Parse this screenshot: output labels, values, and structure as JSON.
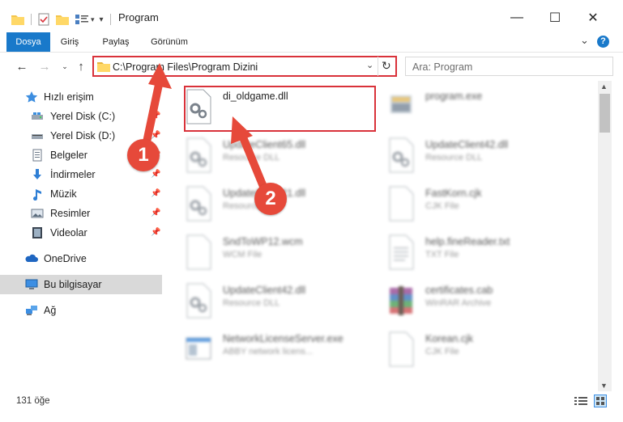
{
  "window": {
    "title": "Program",
    "minimize": "—",
    "maximize": "☐",
    "close": "✕"
  },
  "ribbon": {
    "tabs": [
      {
        "label": "Dosya",
        "active": true
      },
      {
        "label": "Giriş"
      },
      {
        "label": "Paylaş"
      },
      {
        "label": "Görünüm"
      }
    ],
    "expand": "⌄",
    "help": "?"
  },
  "address": {
    "path": "C:\\Program Files\\Program Dizini",
    "search_placeholder": "Ara: Program"
  },
  "nav": {
    "quick_access": "Hızlı erişim",
    "items": [
      {
        "label": "Yerel Disk (C:)",
        "icon": "drive-icon"
      },
      {
        "label": "Yerel Disk (D:)",
        "icon": "drive-icon"
      },
      {
        "label": "Belgeler",
        "icon": "documents-icon"
      },
      {
        "label": "İndirmeler",
        "icon": "download-icon"
      },
      {
        "label": "Müzik",
        "icon": "music-icon"
      },
      {
        "label": "Resimler",
        "icon": "pictures-icon"
      },
      {
        "label": "Videolar",
        "icon": "videos-icon"
      }
    ],
    "onedrive": "OneDrive",
    "this_pc": "Bu bilgisayar",
    "network": "Ağ"
  },
  "files": [
    {
      "name": "di_oldgame.dll",
      "type": "",
      "icon": "dll-gear-icon",
      "highlighted": true
    },
    {
      "name": "program.exe",
      "type": "",
      "icon": "exe-icon"
    },
    {
      "name": "UpdateClient65.dll",
      "type": "Resource DLL",
      "icon": "dll-gear-icon"
    },
    {
      "name": "UpdateClient42.dll",
      "type": "Resource DLL",
      "icon": "dll-gear-icon"
    },
    {
      "name": "UpdateClient21.dll",
      "type": "Resource DLL",
      "icon": "dll-gear-icon"
    },
    {
      "name": "FastKorn.cjk",
      "type": "CJK File",
      "icon": "blank-file-icon"
    },
    {
      "name": "SndToWP12.wcm",
      "type": "WCM File",
      "icon": "blank-file-icon"
    },
    {
      "name": "help.fineReader.txt",
      "type": "TXT File",
      "icon": "text-file-icon"
    },
    {
      "name": "UpdateClient42.dll",
      "type": "Resource DLL",
      "icon": "dll-gear-icon"
    },
    {
      "name": "certificates.cab",
      "type": "WinRAR Archive",
      "icon": "winrar-icon"
    },
    {
      "name": "NetworkLicenseServer.exe",
      "type": "ABBY network licens...",
      "icon": "app-window-icon"
    },
    {
      "name": "Korean.cjk",
      "type": "CJK File",
      "icon": "blank-file-icon"
    }
  ],
  "status": {
    "count": "131 öğe"
  },
  "annotations": {
    "step1": "1",
    "step2": "2"
  },
  "colors": {
    "accent": "#1979ca",
    "highlight": "#d9323a",
    "badge": "#e6493a"
  }
}
